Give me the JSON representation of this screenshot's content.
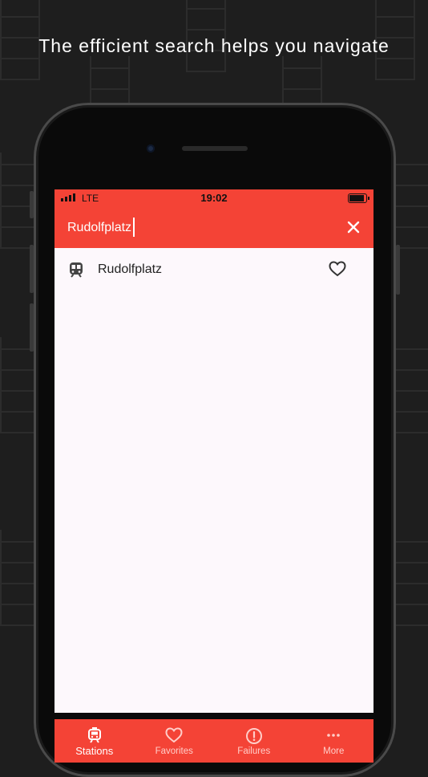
{
  "headline": "The efficient search helps you navigate",
  "status_bar": {
    "carrier": "LTE",
    "time": "19:02",
    "icons": [
      "signal-bars-icon",
      "battery-icon"
    ]
  },
  "search": {
    "value": "Rudolfplatz",
    "clear_icon": "close-icon"
  },
  "results": [
    {
      "label": "Rudolfplatz",
      "icon": "train-icon",
      "action_icon": "heart-outline-icon"
    }
  ],
  "bottom_nav": {
    "items": [
      {
        "label": "Stations",
        "icon": "tram-icon",
        "active": true
      },
      {
        "label": "Favorites",
        "icon": "heart-outline-icon",
        "active": false
      },
      {
        "label": "Failures",
        "icon": "alert-circle-icon",
        "active": false
      },
      {
        "label": "More",
        "icon": "more-dots-icon",
        "active": false
      }
    ]
  },
  "colors": {
    "accent": "#f44336",
    "background": "#1e1e1e",
    "screen": "#fdf8fc",
    "headline": "#ffffff"
  }
}
